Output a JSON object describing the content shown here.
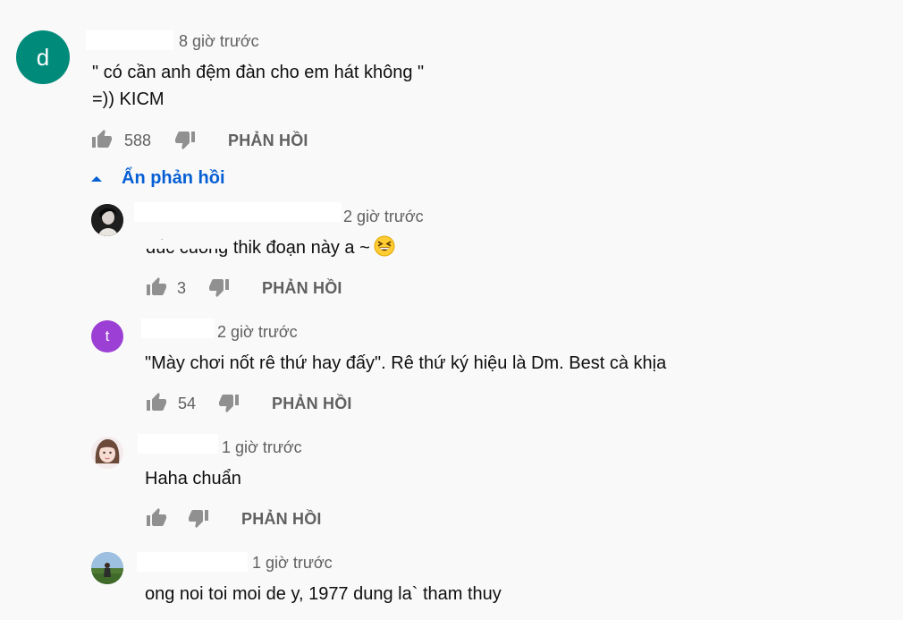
{
  "colors": {
    "accent": "#065fd4",
    "avatar_d": "#008a7a",
    "avatar_t": "#9c3fd4",
    "muted": "#606060"
  },
  "top_comment": {
    "avatar_letter": "d",
    "time": "8 giờ trước",
    "text_line1": "\" có cần anh đệm đàn cho em hát không \"",
    "text_line2": "=)) KICM",
    "likes": "588",
    "reply_label": "PHẢN HỒI"
  },
  "toggle_label": "Ẩn phản hồi",
  "replies": [
    {
      "avatar": "photo-dark",
      "time": "2 giờ trước",
      "text": "đúc cuong thik đoạn này a ~",
      "emoji": "grinning-squinting-face",
      "likes": "3",
      "reply_label": "PHẢN HỒI"
    },
    {
      "avatar_letter": "t",
      "time": "2 giờ trước",
      "text": "\"Mày chơi nốt rê thứ hay đấy\". Rê thứ ký hiệu là Dm. Best cà khịa",
      "likes": "54",
      "reply_label": "PHẢN HỒI"
    },
    {
      "avatar": "photo-girl",
      "time": "1 giờ trước",
      "text": "Haha chuẩn",
      "likes": "",
      "reply_label": "PHẢN HỒI"
    },
    {
      "avatar": "photo-field",
      "time": "1 giờ trước",
      "text": "ong noi toi moi de y, 1977 dung la` tham thuy"
    }
  ]
}
